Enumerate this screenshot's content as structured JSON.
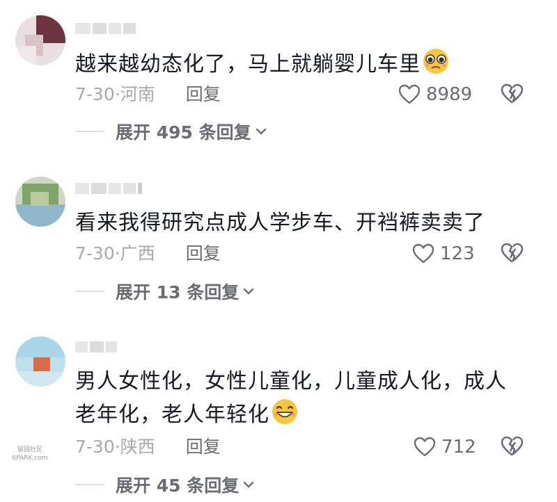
{
  "comments": [
    {
      "text": "越来越幼态化了，马上就躺婴儿车里",
      "date_location": "7-30·河南",
      "reply_label": "回复",
      "likes": "8989",
      "expand_label": "展开 495 条回复",
      "emoji": "pleading-face-emoji"
    },
    {
      "text": "看来我得研究点成人学步车、开裆裤卖卖了",
      "date_location": "7-30·广西",
      "reply_label": "回复",
      "likes": "123",
      "expand_label": "展开 13 条回复"
    },
    {
      "text": "男人女性化，女性儿童化，儿童成人化，成人老年化，老人年轻化",
      "date_location": "7-30·陕西",
      "reply_label": "回复",
      "likes": "712",
      "expand_label": "展开 45 条回复",
      "emoji": "grinning-face-emoji"
    }
  ],
  "watermark": {
    "line1": "留园社区",
    "line2": "6PARK.com"
  },
  "colors": {
    "text": "#161823",
    "meta": "#a8a8ab",
    "action": "#6a6b73",
    "emoji": "#f6c640"
  }
}
